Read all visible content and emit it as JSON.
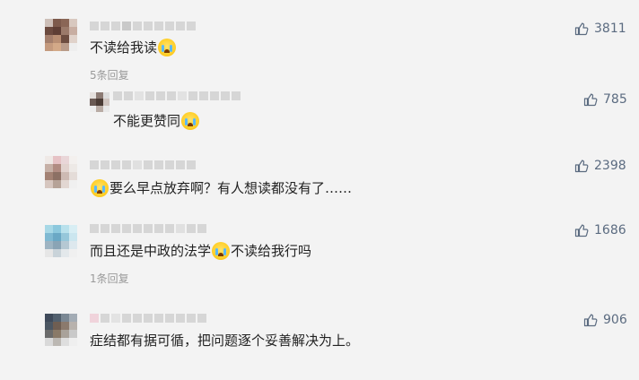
{
  "comments": [
    {
      "text": "不读给我读",
      "emoji_after": true,
      "likes": "3811",
      "reply_link": "5条回复"
    },
    {
      "text": "不能更赞同",
      "emoji_after": true,
      "likes": "785"
    },
    {
      "text": "要么早点放弃啊？有人想读都没有了……",
      "emoji_before": true,
      "likes": "2398"
    },
    {
      "text_a": "而且还是中政的法学",
      "text_b": "不读给我行吗",
      "likes": "1686",
      "reply_link": "1条回复"
    },
    {
      "text": "症结都有据可循，把问题逐个妥善解决为上。",
      "likes": "906"
    }
  ],
  "colors": {
    "background": "#f3f3f3",
    "like": "#5b6b80",
    "muted": "#9a9a9a",
    "text": "#222222"
  },
  "icons": {
    "like": "thumbs-up-icon",
    "emoji": "crying-face-emoji"
  }
}
